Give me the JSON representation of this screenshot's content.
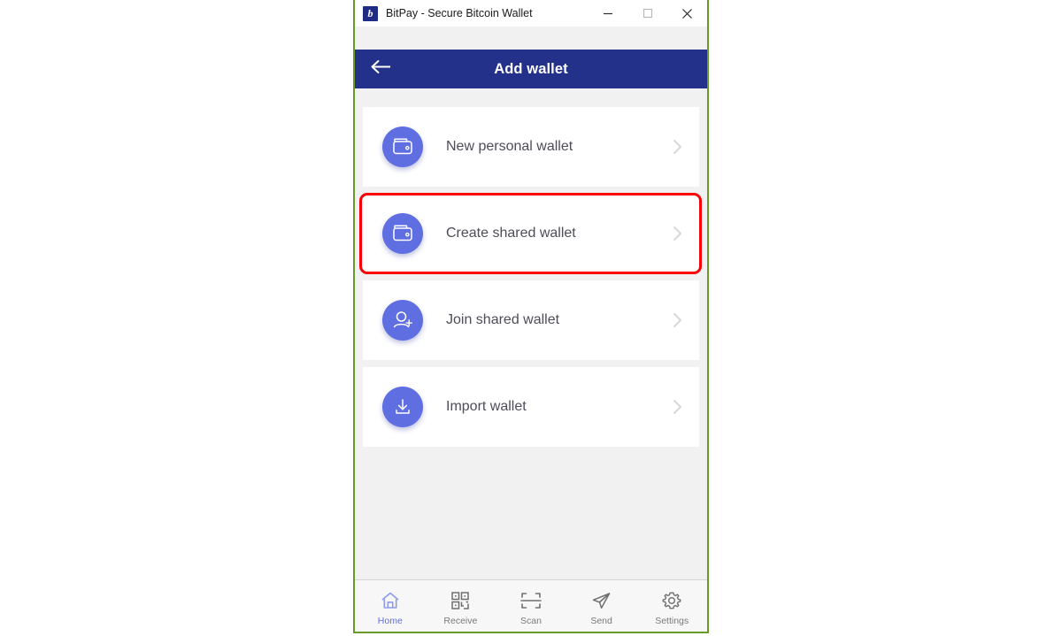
{
  "window": {
    "title": "BitPay - Secure Bitcoin Wallet",
    "logo_letter": "b",
    "controls": [
      {
        "name": "minimize",
        "label": "Minimize"
      },
      {
        "name": "maximize",
        "label": "Maximize"
      },
      {
        "name": "close",
        "label": "Close"
      }
    ]
  },
  "header": {
    "title": "Add wallet",
    "back_icon": "arrow-left-icon",
    "background": "#23318b"
  },
  "highlight": {
    "color": "#fb0007",
    "target": "Create shared wallet"
  },
  "options": [
    {
      "label": "New personal wallet",
      "icon": "wallet-icon",
      "chevron": "chevron-right-icon",
      "highlighted": false
    },
    {
      "label": "Create shared wallet",
      "icon": "wallet-icon",
      "chevron": "chevron-right-icon",
      "highlighted": true
    },
    {
      "label": "Join shared wallet",
      "icon": "person-add-icon",
      "chevron": "chevron-right-icon",
      "highlighted": false
    },
    {
      "label": "Import wallet",
      "icon": "download-icon",
      "chevron": "chevron-right-icon",
      "highlighted": false
    }
  ],
  "bottom_nav": {
    "active": "Home",
    "items": [
      {
        "label": "Home",
        "icon": "home-icon",
        "active": true
      },
      {
        "label": "Receive",
        "icon": "qr-code-icon",
        "active": false
      },
      {
        "label": "Scan",
        "icon": "scan-icon",
        "active": false
      },
      {
        "label": "Send",
        "icon": "paper-plane-icon",
        "active": false
      },
      {
        "label": "Settings",
        "icon": "gear-icon",
        "active": false
      }
    ]
  },
  "colors": {
    "accent": "#5f6ee0",
    "header": "#23318b",
    "highlight": "#fb0007",
    "window_border": "#6a9a28",
    "content_bg": "#f1f1f1"
  }
}
